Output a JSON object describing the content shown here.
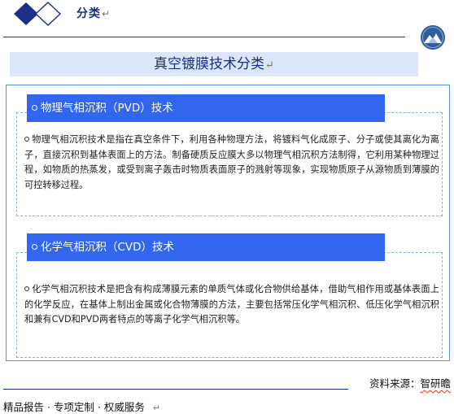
{
  "header": {
    "label": "分类",
    "pilcrow": "↵"
  },
  "colors": {
    "brand_navy": "#1b2e8a",
    "diamond_fill": "#1b2e8a",
    "title_bg": "#dbe7f8",
    "section_header_bg": "#3366ee",
    "frame_border": "#5b8fd6",
    "logo_blue": "#2f5f9e"
  },
  "icons": {
    "header_decoration": "double-diamond-icon",
    "logo": "logo-icon",
    "bullet": "hollow-circle-bullet-icon"
  },
  "title": {
    "text": "真空镀膜技术分类",
    "pilcrow": "↵"
  },
  "sections": [
    {
      "heading": "物理气相沉积（PVD）技术",
      "body": "物理气相沉积技术是指在真空条件下，利用各种物理方法，将镀料气化成原子、分子或使其离化为离子，直接沉积到基体表面上的方法。制备硬质反应膜大多以物理气相沉积方法制得，它利用某种物理过程，如物质的热蒸发，或受到离子轰击时物质表面原子的溅射等现象，实现物质原子从源物质到薄膜的可控转移过程。"
    },
    {
      "heading": "化学气相沉积（CVD）技术",
      "body": "化学气相沉积技术是把含有构成薄膜元素的单质气体或化合物供给基体，借助气相作用或基体表面上的化学反应，在基体上制出金属或化合物薄膜的方法，主要包括常压化学气相沉积、低压化学气相沉积和兼有CVD和PVD两者特点的等离子化学气相沉积等。"
    }
  ],
  "source": {
    "prefix": "资料来源：",
    "brand": "智研瞻"
  },
  "footer": {
    "text": "精品报告 · 专项定制 · 权威服务",
    "pilcrow": "↵"
  }
}
